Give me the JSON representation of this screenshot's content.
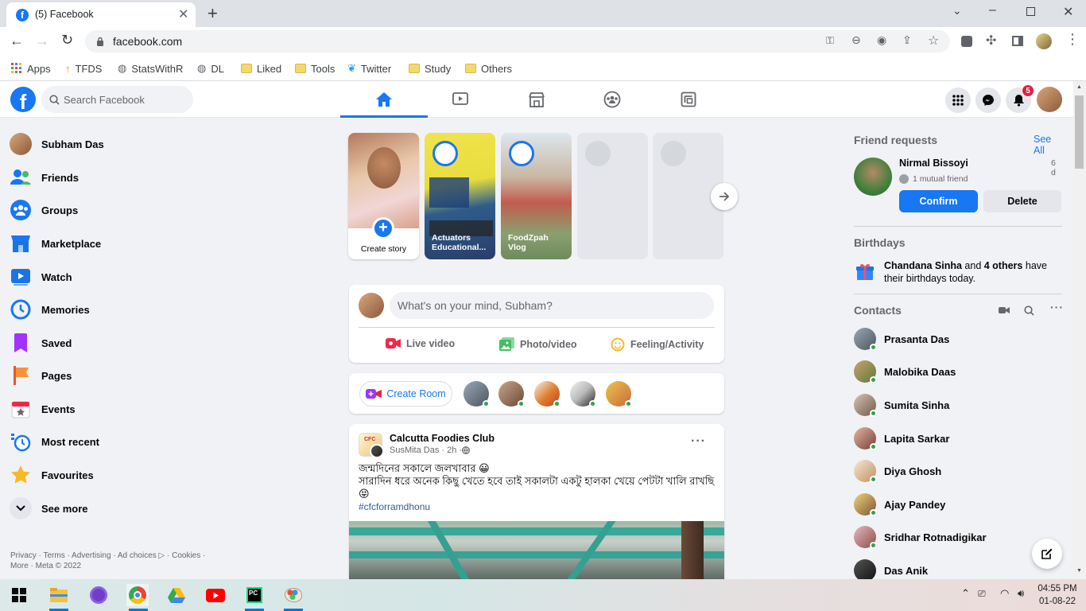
{
  "browser": {
    "tab_title": "(5) Facebook",
    "url": "facebook.com",
    "bookmarks": [
      "Apps",
      "TFDS",
      "StatsWithR",
      "DL",
      "Liked",
      "Tools",
      "Twitter",
      "Study",
      "Others"
    ]
  },
  "header": {
    "search_placeholder": "Search Facebook",
    "notification_count": "5"
  },
  "sidebar": {
    "items": [
      {
        "label": "Subham Das",
        "icon": "profile-avatar"
      },
      {
        "label": "Friends",
        "icon": "friends-icon"
      },
      {
        "label": "Groups",
        "icon": "groups-icon"
      },
      {
        "label": "Marketplace",
        "icon": "marketplace-icon"
      },
      {
        "label": "Watch",
        "icon": "watch-icon"
      },
      {
        "label": "Memories",
        "icon": "memories-icon"
      },
      {
        "label": "Saved",
        "icon": "saved-icon"
      },
      {
        "label": "Pages",
        "icon": "pages-icon"
      },
      {
        "label": "Events",
        "icon": "events-icon"
      },
      {
        "label": "Most recent",
        "icon": "most-recent-icon"
      },
      {
        "label": "Favourites",
        "icon": "favourites-icon"
      },
      {
        "label": "See more",
        "icon": "chevron-down-icon"
      }
    ],
    "footer_line1": "Privacy · Terms · Advertising · Ad choices ▷ · Cookies ·",
    "footer_line2": "More · Meta © 2022"
  },
  "stories": {
    "create_label": "Create story",
    "items": [
      {
        "title": "Actuators Educational..."
      },
      {
        "title": "FoodZpah Vlog"
      }
    ]
  },
  "composer": {
    "placeholder": "What's on your mind, Subham?",
    "live_video": "Live video",
    "photo_video": "Photo/video",
    "feeling": "Feeling/Activity"
  },
  "rooms": {
    "create_room": "Create Room"
  },
  "post": {
    "group": "Calcutta Foodies Club",
    "author_meta": "SusMita Das · 2h · ",
    "line1": "জন্মদিনের সকালে জলখাবার 😀",
    "line2": "সারাদিন ধরে অনেক কিছু খেতে হবে তাই সকালটা একটু হালকা খেয়ে পেটটা খালি রাখছি",
    "emoji": "😝",
    "hashtag": "#cfcforramdhonu"
  },
  "right": {
    "friend_requests_title": "Friend requests",
    "see_all": "See All",
    "request_name": "Nirmal Bissoyi",
    "request_age": "6 d",
    "mutual": "1 mutual friend",
    "confirm": "Confirm",
    "delete": "Delete",
    "birthdays_title": "Birthdays",
    "birthday_name": "Chandana Sinha",
    "birthday_mid": " and ",
    "birthday_others": "4 others",
    "birthday_tail": " have their birthdays today.",
    "contacts_title": "Contacts",
    "contacts": [
      "Prasanta Das",
      "Malobika Daas",
      "Sumita Sinha",
      "Lapita Sarkar",
      "Diya Ghosh",
      "Ajay Pandey",
      "Sridhar Rotnadigikar",
      "Das Anik"
    ]
  },
  "taskbar": {
    "time": "04:55 PM",
    "date": "01-08-22"
  },
  "colors": {
    "brand_blue": "#1877f2",
    "online_green": "#31a24c",
    "notification_red": "#e41e3f"
  }
}
